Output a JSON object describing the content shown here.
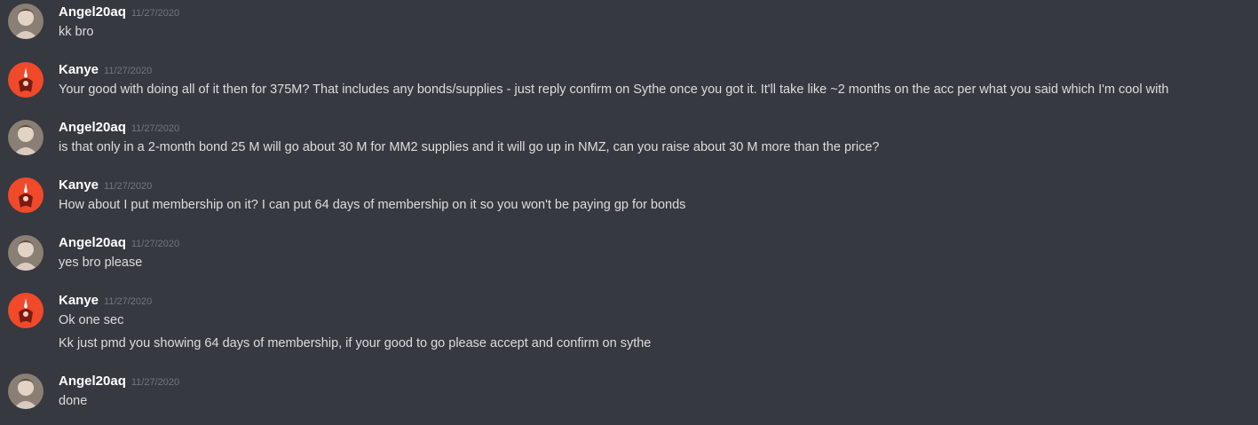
{
  "messages": [
    {
      "author": "Angel20aq",
      "avatar": "angel-avatar",
      "timestamp": "11/27/2020",
      "lines": [
        "kk bro"
      ]
    },
    {
      "author": "Kanye",
      "avatar": "kanye-avatar",
      "timestamp": "11/27/2020",
      "lines": [
        "Your good with doing all of it then for 375M? That includes any bonds/supplies - just reply confirm on Sythe once you got it. It'll take like ~2 months on the acc per what you said which I'm cool with"
      ]
    },
    {
      "author": "Angel20aq",
      "avatar": "angel-avatar",
      "timestamp": "11/27/2020",
      "lines": [
        "is that only in a 2-month bond 25 M will go about 30 M for MM2 supplies and it will go up in NMZ, can you raise about 30 M more than the price?"
      ]
    },
    {
      "author": "Kanye",
      "avatar": "kanye-avatar",
      "timestamp": "11/27/2020",
      "lines": [
        "How about I put membership on it? I can put 64 days of membership on it so you won't be paying gp for bonds"
      ]
    },
    {
      "author": "Angel20aq",
      "avatar": "angel-avatar",
      "timestamp": "11/27/2020",
      "lines": [
        "yes bro please"
      ]
    },
    {
      "author": "Kanye",
      "avatar": "kanye-avatar",
      "timestamp": "11/27/2020",
      "lines": [
        "Ok one sec",
        "Kk just pmd you showing 64 days of membership, if your good to go please accept and confirm on sythe"
      ]
    },
    {
      "author": "Angel20aq",
      "avatar": "angel-avatar",
      "timestamp": "11/27/2020",
      "lines": [
        "done"
      ]
    }
  ],
  "colors": {
    "background": "#36393f",
    "username": "#ffffff",
    "timestamp": "#72767d",
    "message_text": "#dcddde",
    "kanye_avatar": "#f04a2a"
  }
}
